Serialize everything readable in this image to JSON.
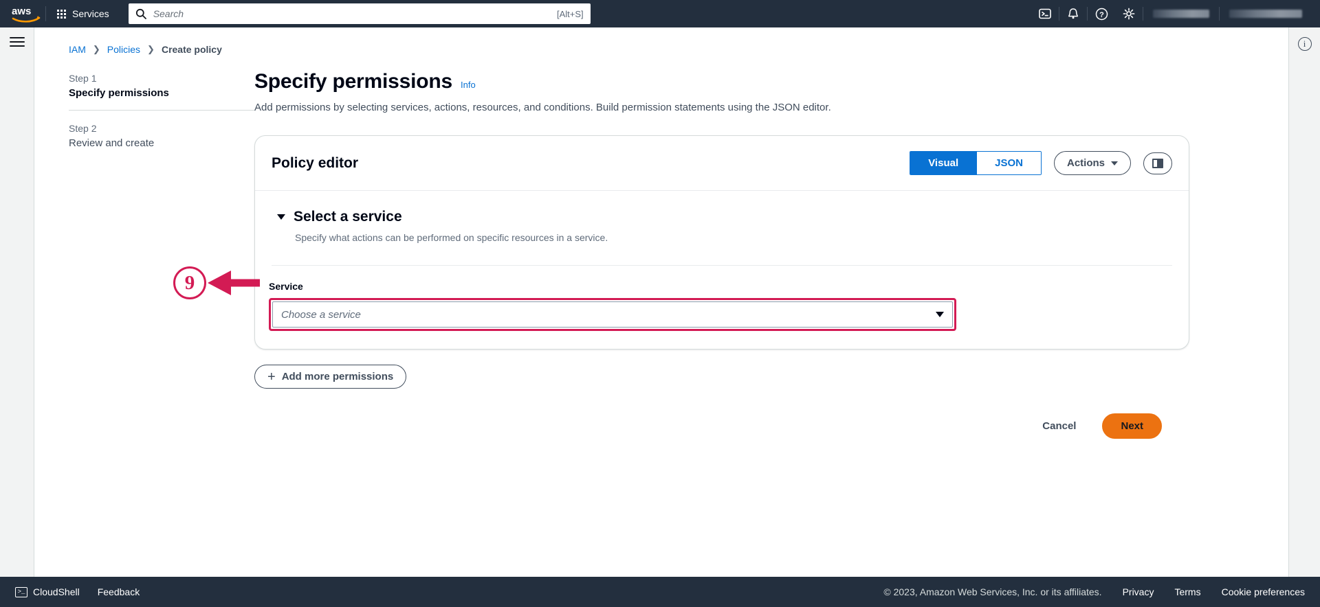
{
  "topnav": {
    "logo_alt": "aws",
    "services_label": "Services",
    "search": {
      "placeholder": "Search",
      "value": "",
      "shortcut_hint": "[Alt+S]"
    },
    "icons": [
      {
        "name": "cloudshell-icon",
        "glyph": ">_"
      },
      {
        "name": "notifications-bell-icon",
        "glyph": "bell"
      },
      {
        "name": "help-icon",
        "glyph": "?"
      },
      {
        "name": "settings-gear-icon",
        "glyph": "gear"
      }
    ],
    "account_redacted": "",
    "region_redacted": ""
  },
  "left_rail": {
    "menu_toggle_name": "hamburger-menu"
  },
  "right_rail": {
    "info_glyph": "i"
  },
  "breadcrumb": {
    "items": [
      {
        "label": "IAM",
        "link": true
      },
      {
        "label": "Policies",
        "link": true
      },
      {
        "label": "Create policy",
        "link": false
      }
    ],
    "separator": "❯"
  },
  "steps": [
    {
      "number": "Step 1",
      "title": "Specify permissions",
      "active": true
    },
    {
      "number": "Step 2",
      "title": "Review and create",
      "active": false
    }
  ],
  "page": {
    "title": "Specify permissions",
    "info_label": "Info",
    "subtitle": "Add permissions by selecting services, actions, resources, and conditions. Build permission statements using the JSON editor."
  },
  "policy_editor": {
    "title": "Policy editor",
    "modes": [
      {
        "label": "Visual",
        "active": true
      },
      {
        "label": "JSON",
        "active": false
      }
    ],
    "actions_label": "Actions",
    "panel_toggle_name": "split-panel-toggle-button"
  },
  "select_service": {
    "heading": "Select a service",
    "description": "Specify what actions can be performed on specific resources in a service.",
    "field_label": "Service",
    "dropdown_placeholder": "Choose a service",
    "dropdown_value": ""
  },
  "add_more_permissions_label": "Add more permissions",
  "form_actions": {
    "cancel_label": "Cancel",
    "next_label": "Next"
  },
  "annotation": {
    "number": "9",
    "color": "#d31b54"
  },
  "footer": {
    "cloudshell_label": "CloudShell",
    "feedback_label": "Feedback",
    "copyright": "© 2023, Amazon Web Services, Inc. or its affiliates.",
    "links": [
      "Privacy",
      "Terms",
      "Cookie preferences"
    ]
  },
  "colors": {
    "aws_navy": "#232f3e",
    "aws_orange": "#ec7211",
    "link_blue": "#0972d3",
    "annotation_red": "#d31b54"
  }
}
